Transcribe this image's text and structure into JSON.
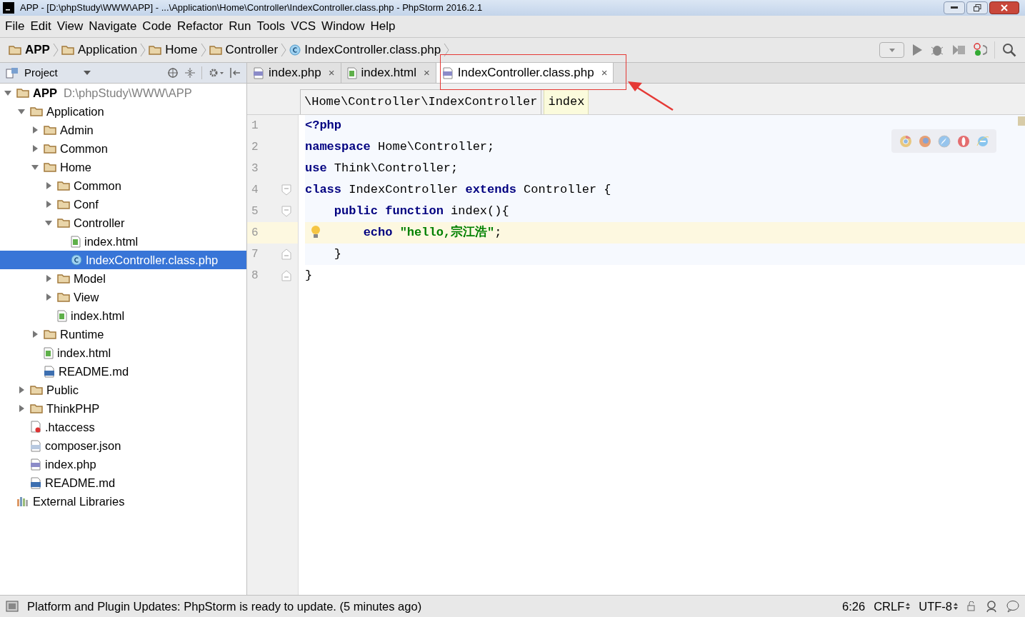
{
  "window": {
    "title": "APP - [D:\\phpStudy\\WWW\\APP] - ...\\Application\\Home\\Controller\\IndexController.class.php - PhpStorm 2016.2.1"
  },
  "menu": [
    "File",
    "Edit",
    "View",
    "Navigate",
    "Code",
    "Refactor",
    "Run",
    "Tools",
    "VCS",
    "Window",
    "Help"
  ],
  "navbar": [
    {
      "label": "APP",
      "kind": "root"
    },
    {
      "label": "Application",
      "kind": "folder"
    },
    {
      "label": "Home",
      "kind": "folder"
    },
    {
      "label": "Controller",
      "kind": "folder"
    },
    {
      "label": "IndexController.class.php",
      "kind": "class"
    }
  ],
  "project_panel": {
    "title": "Project",
    "tree": [
      {
        "label": "APP",
        "hint": "D:\\phpStudy\\WWW\\APP",
        "kind": "root",
        "expanded": true,
        "selected": false,
        "children": [
          {
            "label": "Application",
            "kind": "folder",
            "expanded": true,
            "selected": false,
            "children": [
              {
                "label": "Admin",
                "kind": "folder",
                "expanded": false,
                "selected": false
              },
              {
                "label": "Common",
                "kind": "folder",
                "expanded": false,
                "selected": false
              },
              {
                "label": "Home",
                "kind": "folder",
                "expanded": true,
                "selected": false,
                "children": [
                  {
                    "label": "Common",
                    "kind": "folder",
                    "expanded": false,
                    "selected": false
                  },
                  {
                    "label": "Conf",
                    "kind": "folder",
                    "expanded": false,
                    "selected": false
                  },
                  {
                    "label": "Controller",
                    "kind": "folder",
                    "expanded": true,
                    "selected": false,
                    "children": [
                      {
                        "label": "index.html",
                        "kind": "html",
                        "selected": false
                      },
                      {
                        "label": "IndexController.class.php",
                        "kind": "class",
                        "selected": true
                      }
                    ]
                  },
                  {
                    "label": "Model",
                    "kind": "folder",
                    "expanded": false,
                    "selected": false
                  },
                  {
                    "label": "View",
                    "kind": "folder",
                    "expanded": false,
                    "selected": false
                  },
                  {
                    "label": "index.html",
                    "kind": "html",
                    "selected": false
                  }
                ]
              },
              {
                "label": "Runtime",
                "kind": "folder",
                "expanded": false,
                "selected": false
              },
              {
                "label": "index.html",
                "kind": "html",
                "selected": false
              },
              {
                "label": "README.md",
                "kind": "md",
                "selected": false
              }
            ]
          },
          {
            "label": "Public",
            "kind": "folder",
            "expanded": false,
            "selected": false
          },
          {
            "label": "ThinkPHP",
            "kind": "folder",
            "expanded": false,
            "selected": false
          },
          {
            "label": ".htaccess",
            "kind": "config",
            "selected": false
          },
          {
            "label": "composer.json",
            "kind": "json",
            "selected": false
          },
          {
            "label": "index.php",
            "kind": "php",
            "selected": false
          },
          {
            "label": "README.md",
            "kind": "md",
            "selected": false
          }
        ]
      },
      {
        "label": "External Libraries",
        "kind": "libraries",
        "selected": false
      }
    ]
  },
  "tabs": [
    {
      "label": "index.php",
      "kind": "php",
      "selected": false,
      "close": "×"
    },
    {
      "label": "index.html",
      "kind": "html",
      "selected": false,
      "close": "×"
    },
    {
      "label": "IndexController.class.php",
      "kind": "php",
      "selected": true,
      "close": "×"
    }
  ],
  "editor_breadcrumb": [
    {
      "label": "\\Home\\Controller\\IndexController",
      "kind": "class"
    },
    {
      "label": "index",
      "kind": "method"
    }
  ],
  "code": [
    {
      "number": "1",
      "current": false,
      "fold_open": false,
      "fold_close": false,
      "bulb": false,
      "tokens": [
        {
          "kind": "keyword",
          "text": "<?php"
        }
      ]
    },
    {
      "number": "2",
      "current": false,
      "fold_open": false,
      "fold_close": false,
      "bulb": false,
      "tokens": [
        {
          "kind": "keyword",
          "text": "namespace"
        },
        {
          "kind": "plain",
          "text": " Home\\Controller;"
        }
      ]
    },
    {
      "number": "3",
      "current": false,
      "fold_open": false,
      "fold_close": false,
      "bulb": false,
      "tokens": [
        {
          "kind": "keyword",
          "text": "use"
        },
        {
          "kind": "plain",
          "text": " Think\\Controller;"
        }
      ]
    },
    {
      "number": "4",
      "current": false,
      "fold_open": true,
      "fold_close": false,
      "bulb": false,
      "tokens": [
        {
          "kind": "keyword",
          "text": "class"
        },
        {
          "kind": "plain",
          "text": " IndexController "
        },
        {
          "kind": "keyword",
          "text": "extends"
        },
        {
          "kind": "plain",
          "text": " Controller {"
        }
      ]
    },
    {
      "number": "5",
      "current": false,
      "fold_open": true,
      "fold_close": false,
      "bulb": false,
      "tokens": [
        {
          "kind": "keyword",
          "text": "    public function"
        },
        {
          "kind": "plain",
          "text": " index(){"
        }
      ]
    },
    {
      "number": "6",
      "current": true,
      "fold_open": false,
      "fold_close": false,
      "bulb": true,
      "tokens": [
        {
          "kind": "keyword",
          "text": "        echo"
        },
        {
          "kind": "string",
          "text": " \"hello,宗江浩\""
        },
        {
          "kind": "plain",
          "text": ";"
        }
      ]
    },
    {
      "number": "7",
      "current": false,
      "fold_open": false,
      "fold_close": true,
      "bulb": false,
      "tokens": [
        {
          "kind": "plain",
          "text": "    }"
        }
      ]
    },
    {
      "number": "8",
      "current": false,
      "fold_open": false,
      "fold_close": true,
      "bulb": false,
      "tokens": [
        {
          "kind": "plain",
          "text": "}"
        }
      ]
    }
  ],
  "status_bar": {
    "message": "Platform and Plugin Updates: PhpStorm is ready to update. (5 minutes ago)",
    "position": "6:26",
    "line_separator": "CRLF",
    "encoding": "UTF-8"
  }
}
